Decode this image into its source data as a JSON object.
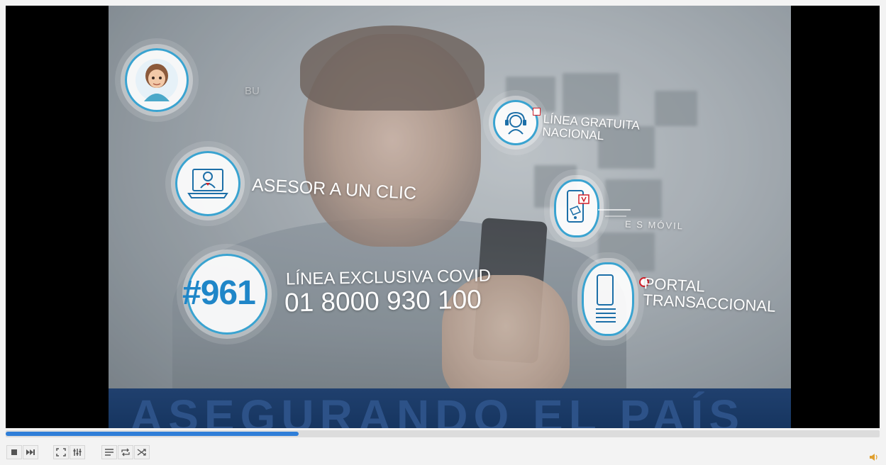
{
  "player": {
    "progress_percent": 33.5,
    "accent_color": "#2f7ed8"
  },
  "video": {
    "overlay_bu": "BU",
    "asesor": "ASESOR A UN CLIC",
    "linea_gratuita_line1": "LÍNEA GRATUITA",
    "linea_gratuita_line2": "NACIONAL",
    "es_movil": "E S MÓVIL",
    "portal_line1": "PORTAL",
    "portal_line2": "TRANSACCIONAL",
    "hash_code": "#961",
    "covid_label": "LÍNEA EXCLUSIVA COVID",
    "covid_number": "01 8000 930 100",
    "band_text": "ASEGURANDO EL PAÍS",
    "brand_blue": "#1f86c8",
    "band_color": "#20406e"
  },
  "controls": {
    "icons": [
      "stop-icon",
      "next-frame-icon",
      "fullscreen-icon",
      "equalizer-icon",
      "playlist-icon",
      "loop-icon",
      "shuffle-icon",
      "volume-icon"
    ]
  }
}
